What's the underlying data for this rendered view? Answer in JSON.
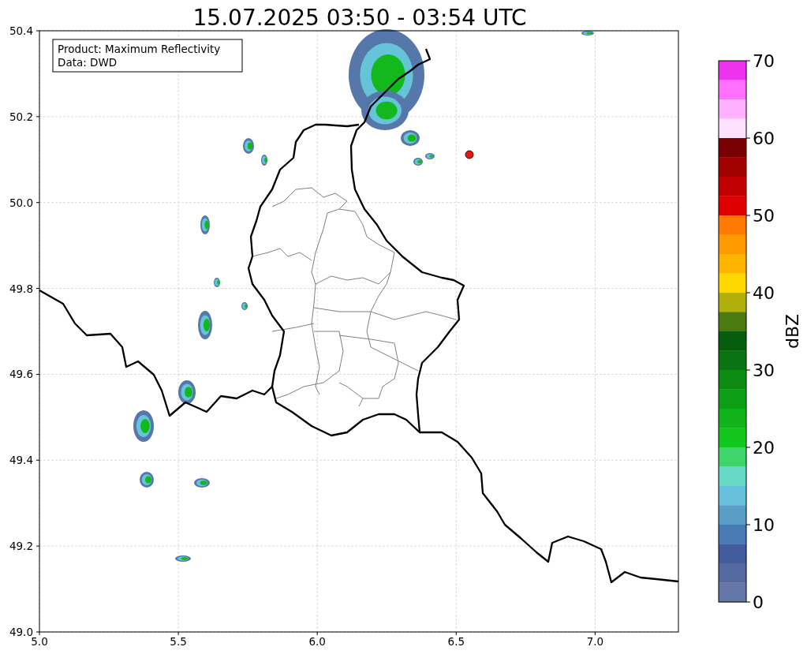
{
  "title": "15.07.2025 03:50 - 03:54 UTC",
  "info_box": [
    "Product: Maximum Reflectivity",
    "Data: DWD"
  ],
  "map": {
    "x_ticks": [
      "5.0",
      "5.5",
      "6.0",
      "6.5",
      "7.0"
    ],
    "y_ticks": [
      "50.4",
      "50.2",
      "50.0",
      "49.8",
      "49.6",
      "49.4",
      "49.2",
      "49.0"
    ]
  },
  "colorbar": {
    "label": "dBZ",
    "ticks": [
      "70",
      "60",
      "50",
      "40",
      "30",
      "20",
      "10",
      "0"
    ],
    "bands": [
      {
        "color": "#ee33ee"
      },
      {
        "color": "#ff70ff"
      },
      {
        "color": "#ffb0ff"
      },
      {
        "color": "#ffe0ff"
      },
      {
        "color": "#780000"
      },
      {
        "color": "#a00000"
      },
      {
        "color": "#c00000"
      },
      {
        "color": "#e00000"
      },
      {
        "color": "#ff7a00"
      },
      {
        "color": "#ff9a00"
      },
      {
        "color": "#ffb400"
      },
      {
        "color": "#ffd800"
      },
      {
        "color": "#b0b00c"
      },
      {
        "color": "#4a7a10"
      },
      {
        "color": "#085c0e"
      },
      {
        "color": "#0a7412"
      },
      {
        "color": "#0c8a14"
      },
      {
        "color": "#0e9e16"
      },
      {
        "color": "#10b41a"
      },
      {
        "color": "#12c61c"
      },
      {
        "color": "#3fd46c"
      },
      {
        "color": "#66d9c6"
      },
      {
        "color": "#66bfdc"
      },
      {
        "color": "#5a9ec8"
      },
      {
        "color": "#4a7ab4"
      },
      {
        "color": "#425c9e"
      },
      {
        "color": "#5568a0"
      },
      {
        "color": "#6477a8"
      }
    ]
  }
}
